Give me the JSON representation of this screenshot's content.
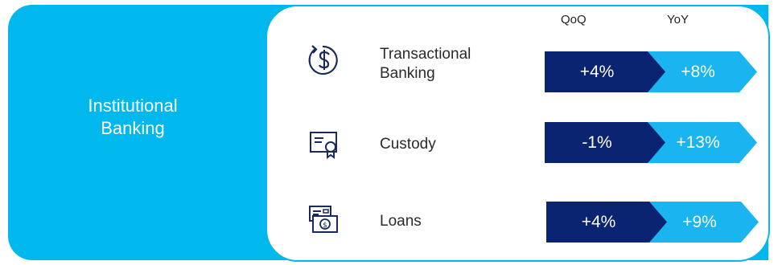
{
  "segment": {
    "title": "Institutional\nBanking"
  },
  "columns": {
    "qoq": "QoQ",
    "yoy": "YoY"
  },
  "rows": [
    {
      "name": "Transactional\nBanking",
      "icon": "dollar-refresh-icon",
      "qoq": "+4%",
      "yoy": "+8%"
    },
    {
      "name": "Custody",
      "icon": "certificate-icon",
      "qoq": "-1%",
      "yoy": "+13%"
    },
    {
      "name": "Loans",
      "icon": "cash-stack-icon",
      "qoq": "+4%",
      "yoy": "+9%"
    }
  ],
  "colors": {
    "segment_blue": "#00b8ee",
    "navy": "#0a2472",
    "light_blue": "#1ab5f0",
    "icon_navy": "#1b2a5a"
  }
}
